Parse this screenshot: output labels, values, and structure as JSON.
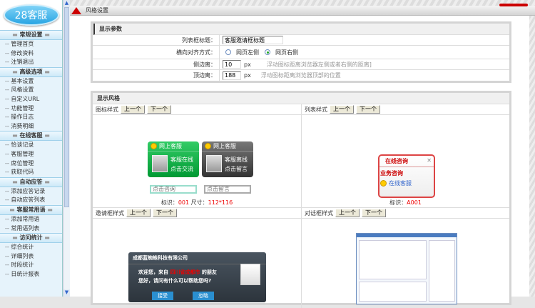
{
  "logo": "28客服",
  "sidebar": [
    {
      "title": "常规设置",
      "items": [
        "管理首页",
        "修改资料",
        "注销退出"
      ]
    },
    {
      "title": "高级选项",
      "items": [
        "基本设置",
        "风格设置",
        "自定义URL",
        "功能管理",
        "操作日志",
        "消费明细"
      ]
    },
    {
      "title": "在线客服",
      "items": [
        "恰谈记录",
        "客服管理",
        "席位管理",
        "获取代码"
      ]
    },
    {
      "title": "自动应答",
      "items": [
        "添加应答记录",
        "自动应答列表"
      ]
    },
    {
      "title": "客服常用语",
      "items": [
        "添加常用语",
        "常用语列表"
      ]
    },
    {
      "title": "访问统计",
      "items": [
        "综合统计",
        "详细列表",
        "时段统计",
        "日统计报表"
      ]
    }
  ],
  "header": {
    "title": "风格设置"
  },
  "params": {
    "title": "显示参数",
    "list_title_label": "列表框标题：",
    "list_title_value": "客服邀请框标题",
    "align_label": "横向对齐方式：",
    "align_left": "网页左侧",
    "align_right": "网页右侧",
    "align_selected": "right",
    "side_label": "侧边离：",
    "side_value": "10",
    "side_unit": "px",
    "side_hint": "浮动图标距离浏览器左侧或者右侧的距离]",
    "top_label": "顶边离：",
    "top_value": "188",
    "top_unit": "px",
    "top_hint": "浮动图标距离浏览器顶部的位置"
  },
  "styles": {
    "title": "显示风格",
    "prev": "上一个",
    "next": "下一个",
    "icon_label": "图标样式",
    "icon_online": {
      "title": "网上客服",
      "l1": "客服在线",
      "l2": "点击交流",
      "input": "点击咨询"
    },
    "icon_offline": {
      "title": "网上客服",
      "l1": "客服离线",
      "l2": "点击留言",
      "input": "点击留言"
    },
    "icon_id_label": "标识：",
    "icon_id": "001",
    "icon_size_label": "尺寸：",
    "icon_size": "112*116",
    "list_label": "列表样式",
    "list_box": {
      "title": "在线咨询",
      "section": "业务咨询",
      "link": "在线客服"
    },
    "list_id_label": "标识：",
    "list_id": "A001",
    "invite_label": "邀请框样式",
    "invite": {
      "company": "成都蓝蜘蛛科技有限公司",
      "l1a": "欢迎您，来自",
      "l1b": "四川省成都市",
      "l1c": "的朋友",
      "l2": "您好，请问有什么可以帮助您吗?",
      "accept": "接受",
      "ignore": "忽略"
    },
    "dialog_label": "对话框样式"
  }
}
